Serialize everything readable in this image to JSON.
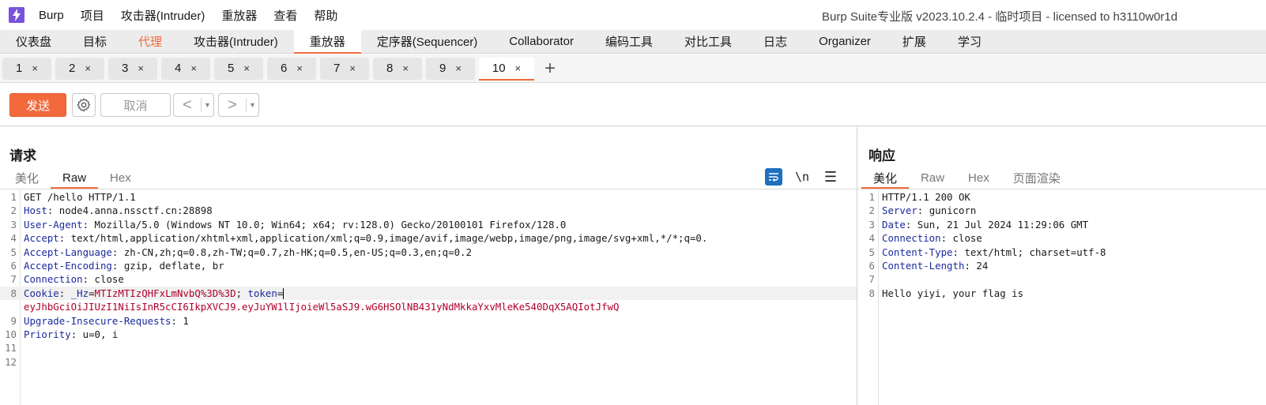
{
  "menubar": {
    "items": [
      "Burp",
      "项目",
      "攻击器(Intruder)",
      "重放器",
      "查看",
      "帮助"
    ],
    "title": "Burp Suite专业版  v2023.10.2.4 - 临时项目 - licensed to h3110w0r1d"
  },
  "main_tabs": [
    "仪表盘",
    "目标",
    "代理",
    "攻击器(Intruder)",
    "重放器",
    "定序器(Sequencer)",
    "Collaborator",
    "编码工具",
    "对比工具",
    "日志",
    "Organizer",
    "扩展",
    "学习"
  ],
  "active_main_tab": "重放器",
  "repeater_tabs": [
    "1",
    "2",
    "3",
    "4",
    "5",
    "6",
    "7",
    "8",
    "9",
    "10"
  ],
  "active_repeater_tab": "10",
  "tab_close_glyph": "×",
  "add_tab_glyph": "+",
  "toolbar": {
    "send_label": "发送",
    "cancel_label": "取消",
    "prev_glyph": "<",
    "next_glyph": ">",
    "dropdown_glyph": "▼"
  },
  "request": {
    "title": "请求",
    "tabs": [
      "美化",
      "Raw",
      "Hex"
    ],
    "active_tab": "Raw",
    "newline_label": "\\n",
    "menu_glyph": "☰",
    "line_numbers": [
      "1",
      "2",
      "3",
      "4",
      "5",
      "6",
      "7",
      "8",
      "9",
      "10",
      "11",
      "12"
    ],
    "lines": [
      {
        "n": "1",
        "plain": "GET /hello HTTP/1.1"
      },
      {
        "n": "2",
        "key": "Host",
        "value": " node4.anna.nssctf.cn:28898"
      },
      {
        "n": "3",
        "key": "User-Agent",
        "value": " Mozilla/5.0 (Windows NT 10.0; Win64; x64; rv:128.0) Gecko/20100101 Firefox/128.0"
      },
      {
        "n": "4",
        "key": "Accept",
        "value": " text/html,application/xhtml+xml,application/xml;q=0.9,image/avif,image/webp,image/png,image/svg+xml,*/*;q=0."
      },
      {
        "n": "5",
        "key": "Accept-Language",
        "value": " zh-CN,zh;q=0.8,zh-TW;q=0.7,zh-HK;q=0.5,en-US;q=0.3,en;q=0.2"
      },
      {
        "n": "6",
        "key": "Accept-Encoding",
        "value": " gzip, deflate, br"
      },
      {
        "n": "7",
        "key": "Connection",
        "value": " close"
      },
      {
        "n": "8",
        "key": "Cookie",
        "cookie1_name": "_Hz",
        "cookie1_value": "MTIzMTIzQHFxLmNvbQ%3D%3D",
        "cookie2_name": "token",
        "continuation": "eyJhbGciOiJIUzI1NiIsInR5cCI6IkpXVCJ9.eyJuYW1lIjoieWl5aSJ9.wG6HSOlNB431yNdMkkaYxvMleKe540DqX5AQIotJfwQ"
      },
      {
        "n": "9",
        "key": "Upgrade-Insecure-Requests",
        "value": " 1"
      },
      {
        "n": "10",
        "key": "Priority",
        "value": " u=0, i"
      },
      {
        "n": "11",
        "plain": ""
      },
      {
        "n": "12",
        "plain": ""
      }
    ]
  },
  "response": {
    "title": "响应",
    "tabs": [
      "美化",
      "Raw",
      "Hex",
      "页面渲染"
    ],
    "active_tab": "美化",
    "lines": [
      {
        "n": "1",
        "plain": "HTTP/1.1 200 OK"
      },
      {
        "n": "2",
        "key": "Server",
        "value": " gunicorn"
      },
      {
        "n": "3",
        "key": "Date",
        "value": " Sun, 21 Jul 2024 11:29:06 GMT"
      },
      {
        "n": "4",
        "key": "Connection",
        "value": " close"
      },
      {
        "n": "5",
        "key": "Content-Type",
        "value": " text/html; charset=utf-8"
      },
      {
        "n": "6",
        "key": "Content-Length",
        "value": " 24"
      },
      {
        "n": "7",
        "plain": ""
      },
      {
        "n": "8",
        "plain": "Hello yiyi, your flag is"
      }
    ]
  },
  "colors": {
    "accent": "#f06a3a",
    "send_button": "#f26a3c",
    "header_key": "#1a2a9c",
    "cookie_value": "#b0002a",
    "logo": "#7a52d8"
  }
}
